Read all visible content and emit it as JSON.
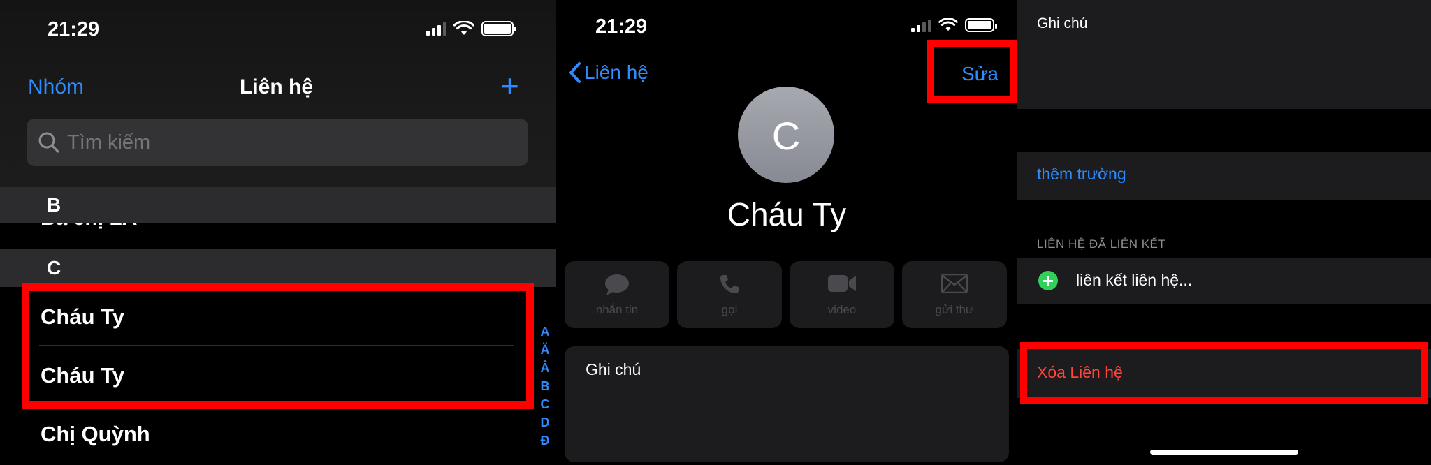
{
  "panel1": {
    "status": {
      "time": "21:29"
    },
    "nav": {
      "left": "Nhóm",
      "title": "Liên hệ",
      "right": "+"
    },
    "search": {
      "placeholder": "Tìm kiếm"
    },
    "sections": [
      {
        "letter": "B",
        "ghost_row": "Bà chị LA"
      },
      {
        "letter": "C"
      }
    ],
    "rows": [
      "Cháu Ty",
      "Cháu Ty",
      "Chị Quỳnh"
    ],
    "index": [
      "A",
      "Ă",
      "Â",
      "B",
      "C",
      "D",
      "Đ"
    ]
  },
  "panel2": {
    "status": {
      "time": "21:29"
    },
    "nav": {
      "back": "Liên hệ",
      "edit": "Sửa"
    },
    "avatar_initial": "C",
    "name": "Cháu Ty",
    "actions": [
      {
        "label": "nhắn tin",
        "icon": "message-icon"
      },
      {
        "label": "gọi",
        "icon": "phone-icon"
      },
      {
        "label": "video",
        "icon": "video-icon"
      },
      {
        "label": "gửi thư",
        "icon": "mail-icon"
      }
    ],
    "notes_label": "Ghi chú"
  },
  "panel3": {
    "notes_label": "Ghi chú",
    "add_field": "thêm trường",
    "linked_section": "LIÊN HỆ ĐÃ LIÊN KẾT",
    "link_contact": "liên kết liên hệ...",
    "delete_contact": "Xóa Liên hệ"
  },
  "colors": {
    "accent": "#2f8cff",
    "highlight": "#ff0000",
    "destructive": "#ff453a",
    "add": "#30d158"
  }
}
